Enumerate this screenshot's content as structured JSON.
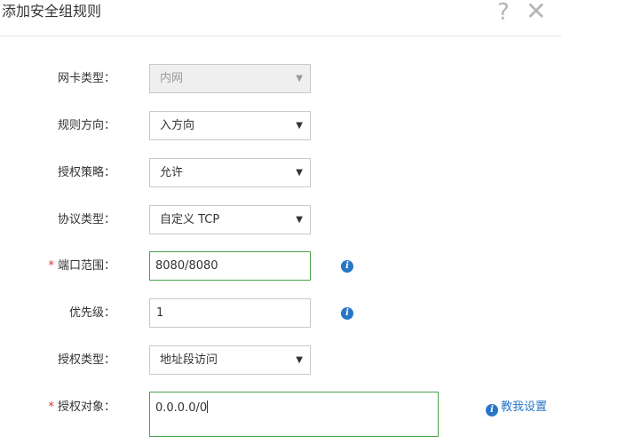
{
  "dialog": {
    "title": "添加安全组规则",
    "help_glyph": "?",
    "close_glyph": "✕"
  },
  "form": {
    "nic_type": {
      "label": "网卡类型：",
      "value": "内网",
      "disabled": true
    },
    "rule_direction": {
      "label": "规则方向：",
      "value": "入方向"
    },
    "auth_policy": {
      "label": "授权策略：",
      "value": "允许"
    },
    "protocol_type": {
      "label": "协议类型：",
      "value": "自定义 TCP"
    },
    "port_range": {
      "label": "端口范围：",
      "value": "8080/8080",
      "required": true,
      "required_mark": "*"
    },
    "priority": {
      "label": "优先级：",
      "value": "1"
    },
    "auth_type": {
      "label": "授权类型：",
      "value": "地址段访问"
    },
    "auth_object": {
      "label": "授权对象：",
      "value": "0.0.0.0/0",
      "required": true,
      "required_mark": "*"
    }
  },
  "help_link": {
    "label": "教我设置"
  },
  "icons": {
    "dropdown": "▼",
    "info": "i"
  },
  "colors": {
    "required": "#e0311d",
    "focus_border": "#4aa24a",
    "link": "#2a76c6",
    "info_icon": "#2a76c6"
  }
}
